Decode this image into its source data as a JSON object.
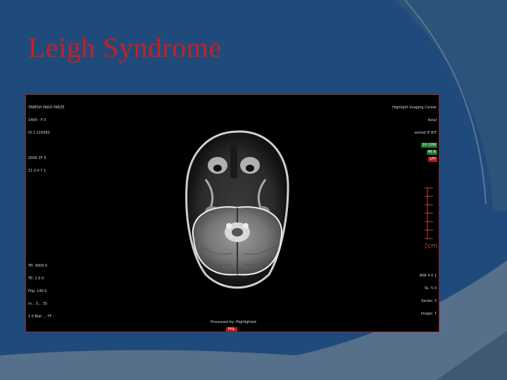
{
  "slide": {
    "title": "Leigh Syndrome"
  },
  "mri": {
    "top_left": [
      "TABESH FARD FAEZE",
      "1400 - F II",
      "ID 1 210582",
      "",
      "2009 2F 3",
      "11 0 II 7 1"
    ],
    "top_right": [
      "Highlight Imaging Center",
      "Axial",
      "sorted IP BIT"
    ],
    "bottom_left": [
      "TR: 3000.0",
      "TE: 1 0 0",
      "Flip: 140 0",
      "m... 5... 35",
      "1 0 Blat ... TF"
    ],
    "bottom_right": [
      "WW 4 0 1",
      "SL: 5 0",
      "Series: 3",
      "Image: 7"
    ],
    "bottom_center": "Processed by: Highlighted",
    "tags": {
      "green1": "10 22W",
      "green2": "46 R",
      "red": "LFP",
      "bottom": "PHL"
    },
    "cm_label": "[cm"
  },
  "colors": {
    "background": "#1f4a7c",
    "title": "#c8201f",
    "frame_border": "#9b1c1c"
  }
}
